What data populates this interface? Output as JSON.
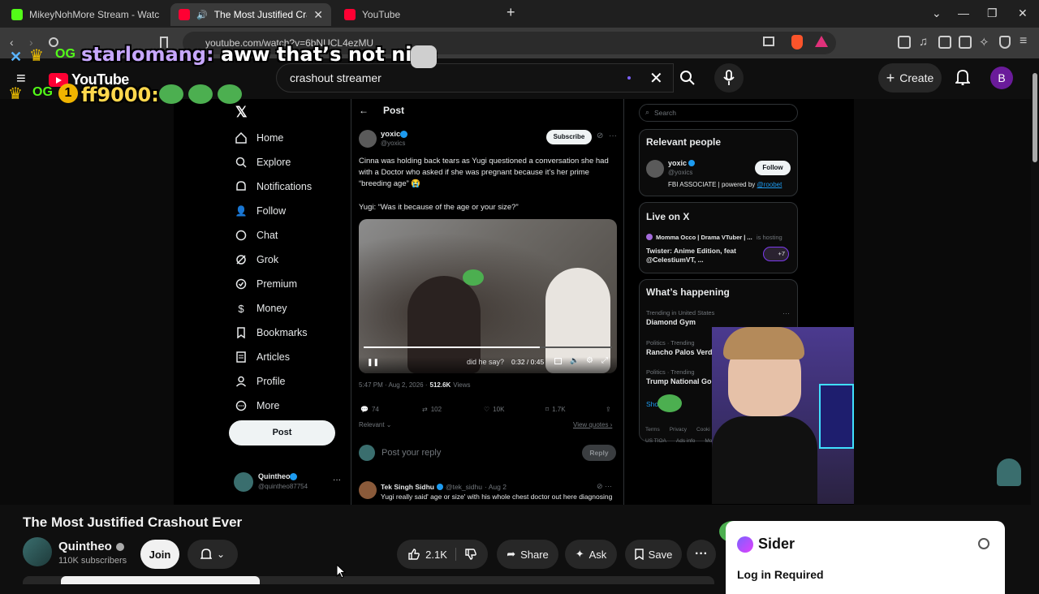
{
  "browser": {
    "tabs": [
      {
        "title": "MikeyNohMore Stream - Watch Live",
        "fav_color": "#53fc18"
      },
      {
        "title": "The Most Justified Crashout E",
        "fav_color": "#ff0033"
      },
      {
        "title": "YouTube",
        "fav_color": "#ff0033"
      }
    ],
    "url": "youtube.com/watch?v=6bNUCL4ezMU"
  },
  "youtube": {
    "logo": "YouTube",
    "search_value": "crashout streamer",
    "create_label": "Create",
    "avatar_letter": "B"
  },
  "chat": [
    {
      "user": "starlomang:",
      "message": "aww that’s not nice"
    },
    {
      "user": "ff9000:",
      "message": ""
    }
  ],
  "x": {
    "nav": [
      "Home",
      "Explore",
      "Notifications",
      "Follow",
      "Chat",
      "Grok",
      "Premium",
      "Money",
      "Bookmarks",
      "Articles",
      "Profile",
      "More"
    ],
    "post_button": "Post",
    "account": {
      "name": "Quintheo",
      "handle": "@quintheo87754"
    },
    "header_title": "Post",
    "author": {
      "name": "yoxic",
      "handle": "@yoxics"
    },
    "subscribe_label": "Subscribe",
    "tweet_line1": "Cinna was holding back tears as Yugi questioned a conversation she had with a Doctor who asked if she was pregnant because it’s her prime “breeding age” 😭",
    "tweet_line2": "Yugi: “Was it because of the age or your size?”",
    "video": {
      "caption": "did he say?",
      "time": "0:32 / 0:45",
      "progress": 0.71
    },
    "meta_time": "5:47 PM · Aug 2, 2026 ·",
    "meta_views_num": "512.6K",
    "meta_views_label": "Views",
    "stats": {
      "replies": "74",
      "reposts": "102",
      "likes": "10K",
      "bookmarks": "1.7K"
    },
    "relevant_label": "Relevant",
    "view_quotes": "View quotes",
    "reply_placeholder": "Post your reply",
    "reply_button": "Reply",
    "reply_tweet": {
      "name": "Tek Singh Sidhu",
      "handle": "@tek_sidhu",
      "date": "· Aug 2",
      "text": "Yugi really said' age or size' with his whole chest doctor out here diagnosing"
    },
    "search_placeholder": "Search",
    "relevant_people": {
      "title": "Relevant people",
      "name": "yoxic",
      "handle": "@yoxics",
      "follow_label": "Follow",
      "bio_prefix": "FBI ASSOCIATE | powered by ",
      "bio_link": "@roobet"
    },
    "live": {
      "title": "Live on X",
      "host": "Momma Occo | Drama VTuber | ...",
      "host_suffix": "is hosting",
      "show_title": "Twister: Anime Edition, feat @CelestiumVT, ...",
      "count": "+7"
    },
    "happening": {
      "title": "What’s happening",
      "items": [
        {
          "context": "Trending in United States",
          "topic": "Diamond Gym"
        },
        {
          "context": "Politics · Trending",
          "topic": "Rancho Palos Verdes"
        },
        {
          "context": "Politics · Trending",
          "topic": "Trump National Golf"
        }
      ],
      "show_more": "Sho"
    },
    "footer": [
      "Terms",
      "Privacy",
      "Cooki",
      "US TIOA",
      "Ads info",
      "Mo"
    ]
  },
  "below": {
    "title": "The Most Justified Crashout Ever",
    "channel": "Quintheo",
    "subscribers": "110K subscribers",
    "join_label": "Join",
    "likes": "2.1K",
    "share_label": "Share",
    "ask_label": "Ask",
    "save_label": "Save"
  },
  "sider": {
    "brand": "Sider",
    "message": "Log in Required"
  }
}
